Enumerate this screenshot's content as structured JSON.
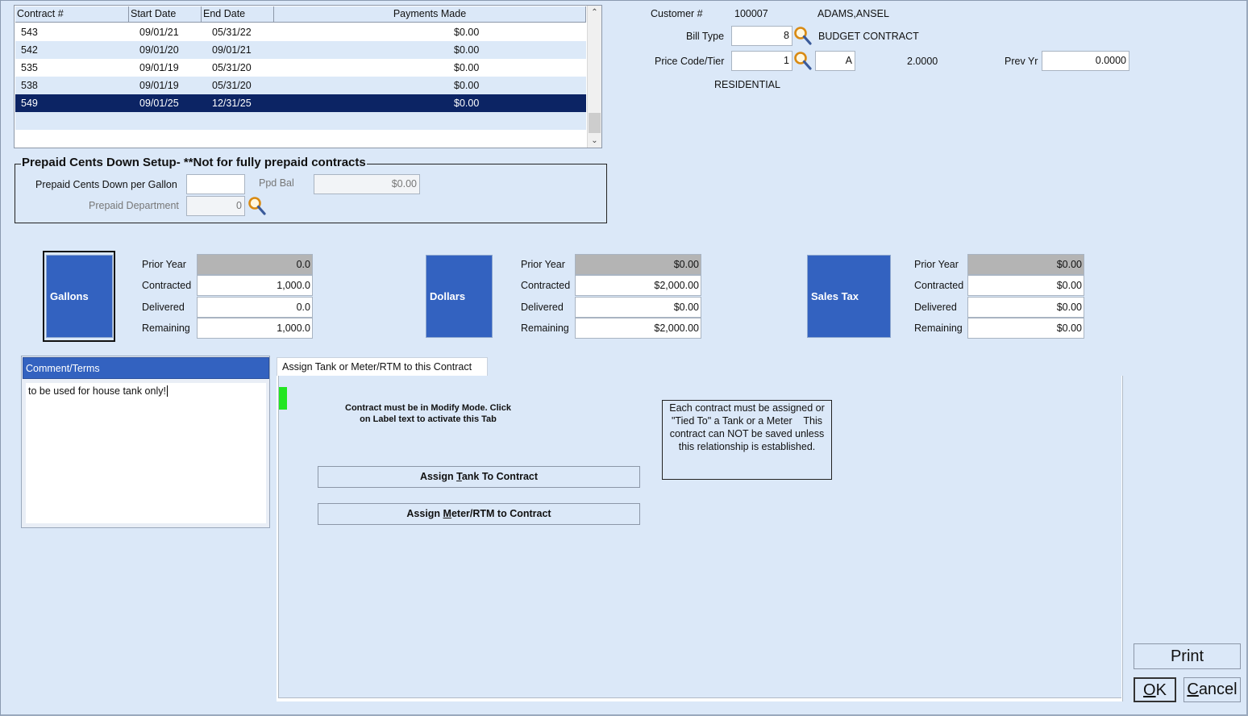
{
  "contracts_grid": {
    "columns": [
      "Contract #",
      "Start Date",
      "End Date",
      "Payments Made"
    ],
    "rows": [
      {
        "contract": "543",
        "start": "09/01/21",
        "end": "05/31/22",
        "payments": "$0.00"
      },
      {
        "contract": "542",
        "start": "09/01/20",
        "end": "09/01/21",
        "payments": "$0.00"
      },
      {
        "contract": "535",
        "start": "09/01/19",
        "end": "05/31/20",
        "payments": "$0.00"
      },
      {
        "contract": "538",
        "start": "09/01/19",
        "end": "05/31/20",
        "payments": "$0.00"
      },
      {
        "contract": "549",
        "start": "09/01/25",
        "end": "12/31/25",
        "payments": "$0.00"
      }
    ],
    "selected_row": 4
  },
  "customer": {
    "label": "Customer #",
    "number": "100007",
    "name": "ADAMS,ANSEL"
  },
  "bill_type": {
    "label": "Bill Type",
    "value": "8",
    "description": "BUDGET CONTRACT"
  },
  "price_code": {
    "label": "Price Code/Tier",
    "value": "1",
    "tier": "A",
    "price": "2.0000",
    "prev_yr_label": "Prev Yr",
    "prev_yr_value": "0.0000",
    "description": "RESIDENTIAL"
  },
  "prepaid": {
    "legend": "Prepaid Cents Down Setup- **Not for fully prepaid contracts",
    "cents_label": "Prepaid Cents Down per Gallon",
    "cents_value": "",
    "ppd_bal_label": "Ppd Bal",
    "ppd_bal_value": "$0.00",
    "dept_label": "Prepaid Department",
    "dept_value": "0"
  },
  "summary_labels": {
    "prior_year": "Prior Year",
    "contracted": "Contracted",
    "delivered": "Delivered",
    "remaining": "Remaining"
  },
  "gallons": {
    "button": "Gallons",
    "prior_year": "0.0",
    "contracted": "1,000.0",
    "delivered": "0.0",
    "remaining": "1,000.0"
  },
  "dollars": {
    "button": "Dollars",
    "prior_year": "$0.00",
    "contracted": "$2,000.00",
    "delivered": "$0.00",
    "remaining": "$2,000.00"
  },
  "sales_tax": {
    "button": "Sales Tax",
    "prior_year": "$0.00",
    "contracted": "$0.00",
    "delivered": "$0.00",
    "remaining": "$0.00"
  },
  "comment": {
    "header": "Comment/Terms",
    "text": "to be used for house tank only!"
  },
  "assign_tab": {
    "tab_label": "Assign Tank or Meter/RTM to this Contract",
    "modify_note_line1": "Contract must be in Modify Mode.  Click",
    "modify_note_line2": "on Label text to activate this Tab",
    "info_line1": "Each contract must be assigned or",
    "info_line2": "\"Tied To\" a Tank or a Meter    This",
    "info_line3": "contract can NOT be saved unless",
    "info_line4": "this relationship is established.",
    "assign_tank_pre": "Assign ",
    "assign_tank_key": "T",
    "assign_tank_post": "ank To Contract",
    "assign_meter_pre": "Assign ",
    "assign_meter_key": "M",
    "assign_meter_post": "eter/RTM to Contract"
  },
  "buttons": {
    "print": "Print",
    "ok_key": "O",
    "ok_rest": "K",
    "cancel_key": "C",
    "cancel_rest": "ancel"
  }
}
